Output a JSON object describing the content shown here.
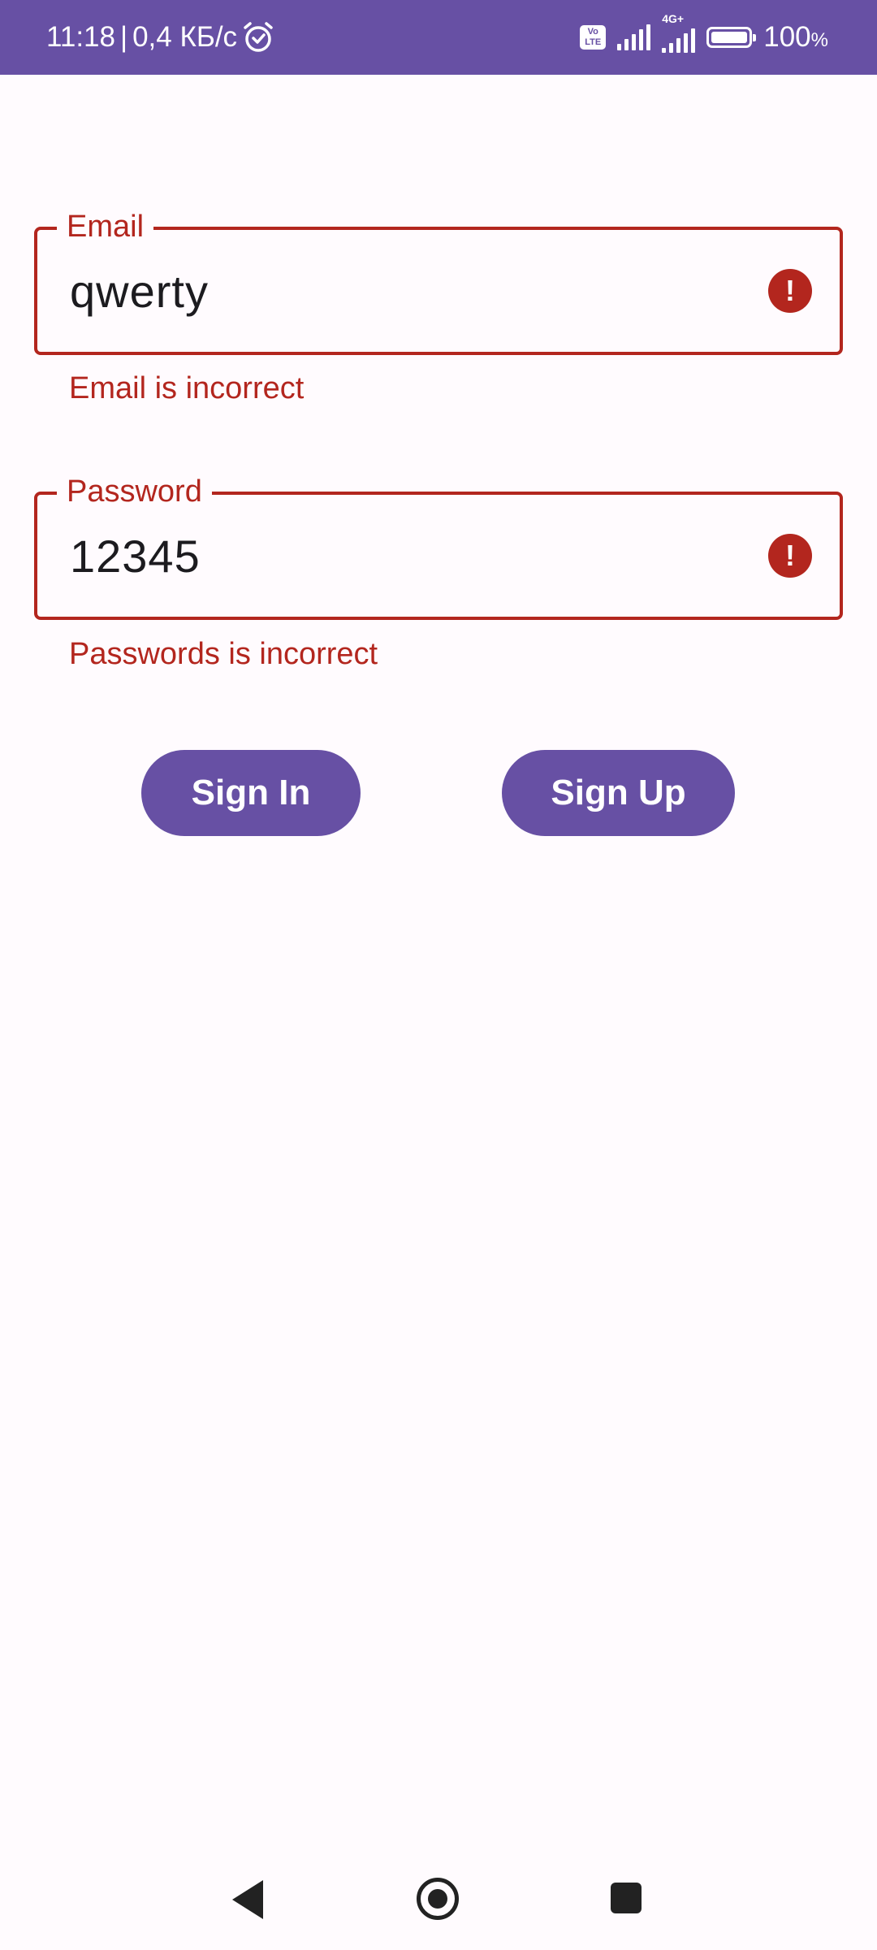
{
  "status_bar": {
    "time": "11:18",
    "separator": "|",
    "net_speed": "0,4 КБ/с",
    "volte_top": "Vo",
    "volte_bottom": "LTE",
    "network_type": "4G+",
    "battery_level": "100",
    "battery_unit": "%",
    "icons": [
      "alarm-icon",
      "volte-icon",
      "signal-icon",
      "signal-4g-icon",
      "battery-icon"
    ]
  },
  "form": {
    "email": {
      "label": "Email",
      "value": "qwerty",
      "error": "Email is incorrect",
      "icon": "error-icon"
    },
    "password": {
      "label": "Password",
      "value": "12345",
      "error": "Passwords is incorrect",
      "icon": "error-icon"
    },
    "error_icon_glyph": "!"
  },
  "buttons": {
    "sign_in": "Sign In",
    "sign_up": "Sign Up"
  },
  "navigation": {
    "icons": [
      "back-icon",
      "home-icon",
      "recents-icon"
    ]
  },
  "colors": {
    "primary": "#6750a4",
    "error": "#b3261e",
    "background": "#fffbfe",
    "on_surface": "#1c1b1f"
  }
}
